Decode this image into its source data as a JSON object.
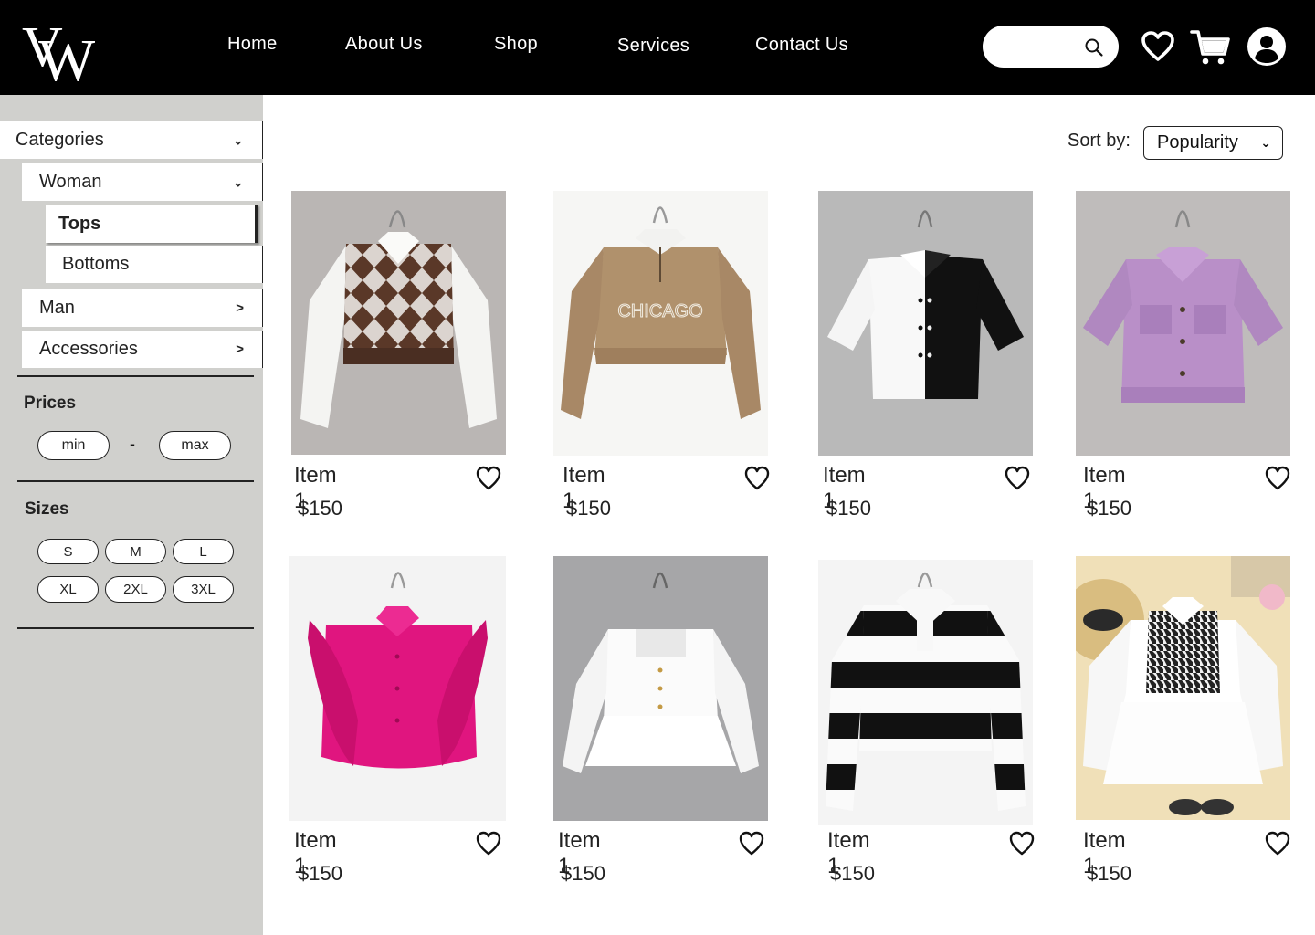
{
  "brand": {
    "logo_text": "W",
    "logo_icon": "vw-monogram-logo"
  },
  "nav": {
    "items": [
      {
        "label": "Home"
      },
      {
        "label": "About Us"
      },
      {
        "label": "Shop"
      },
      {
        "label": "Services"
      },
      {
        "label": "Contact Us"
      }
    ]
  },
  "search": {
    "placeholder": "",
    "icon": "search-icon"
  },
  "header_icons": [
    "heart-icon",
    "cart-icon",
    "user-avatar-icon"
  ],
  "sidebar": {
    "categories": {
      "label": "Categories",
      "items": [
        {
          "label": "Woman",
          "expanded": true,
          "children": [
            {
              "label": "Tops",
              "selected": true
            },
            {
              "label": "Bottoms"
            }
          ]
        },
        {
          "label": "Man",
          "expanded": false
        },
        {
          "label": "Accessories",
          "expanded": false
        }
      ]
    },
    "prices": {
      "heading": "Prices",
      "min_placeholder": "min",
      "max_placeholder": "max",
      "separator": "-"
    },
    "sizes": {
      "heading": "Sizes",
      "options": [
        "S",
        "M",
        "L",
        "XL",
        "2XL",
        "3XL"
      ]
    }
  },
  "sort": {
    "label": "Sort by:",
    "selected": "Popularity"
  },
  "products": [
    {
      "name": "Item 1",
      "price": "$150",
      "image": "argyle-vest-collared-top"
    },
    {
      "name": "Item 1",
      "price": "$150",
      "image": "tan-cropped-sweatshirt"
    },
    {
      "name": "Item 1",
      "price": "$150",
      "image": "black-white-colorblock-shirt"
    },
    {
      "name": "Item 1",
      "price": "$150",
      "image": "lilac-cropped-shirt"
    },
    {
      "name": "Item 1",
      "price": "$150",
      "image": "pink-ruffle-blouse"
    },
    {
      "name": "Item 1",
      "price": "$150",
      "image": "white-peplum-blouse"
    },
    {
      "name": "Item 1",
      "price": "$150",
      "image": "striped-rugby-polo"
    },
    {
      "name": "Item 1",
      "price": "$150",
      "image": "houndstooth-vest-dress"
    }
  ],
  "colors": {
    "header_bg": "#000000",
    "sidebar_bg": "#d0d0cd"
  }
}
